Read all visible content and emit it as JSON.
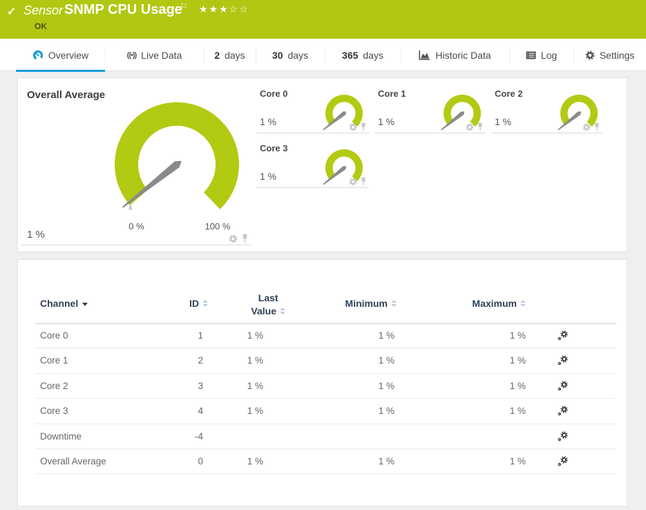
{
  "header": {
    "check": "✓",
    "kind": "Sensor",
    "title": "SNMP CPU Usage",
    "flag": "⚐",
    "stars_filled": "★★★",
    "stars_empty": "☆☆",
    "status": "OK"
  },
  "tabs": {
    "overview_label": "Overview",
    "live_label": "Live Data",
    "d2_num": "2",
    "d2_label": "days",
    "d30_num": "30",
    "d30_label": "days",
    "d365_num": "365",
    "d365_label": "days",
    "historic_label": "Historic Data",
    "log_label": "Log",
    "settings_label": "Settings",
    "live_icon_glyph": "((•))"
  },
  "gauges": {
    "overall": {
      "title": "Overall Average",
      "value": 1,
      "value_label": "1 %",
      "min_label": "0 %",
      "max_label": "100 %",
      "mean_marker": "x̄"
    },
    "cores": [
      {
        "title": "Core 0",
        "value": 1,
        "value_label": "1 %"
      },
      {
        "title": "Core 1",
        "value": 1,
        "value_label": "1 %"
      },
      {
        "title": "Core 2",
        "value": 1,
        "value_label": "1 %"
      },
      {
        "title": "Core 3",
        "value": 1,
        "value_label": "1 %"
      }
    ]
  },
  "table": {
    "headers": {
      "channel": "Channel",
      "id": "ID",
      "last_line1": "Last",
      "last_line2": "Value",
      "minimum": "Minimum",
      "maximum": "Maximum"
    },
    "rows": [
      {
        "channel": "Core 0",
        "id": "1",
        "last": "1 %",
        "min": "1 %",
        "max": "1 %"
      },
      {
        "channel": "Core 1",
        "id": "2",
        "last": "1 %",
        "min": "1 %",
        "max": "1 %"
      },
      {
        "channel": "Core 2",
        "id": "3",
        "last": "1 %",
        "min": "1 %",
        "max": "1 %"
      },
      {
        "channel": "Core 3",
        "id": "4",
        "last": "1 %",
        "min": "1 %",
        "max": "1 %"
      },
      {
        "channel": "Downtime",
        "id": "-4",
        "last": "",
        "min": "",
        "max": ""
      },
      {
        "channel": "Overall Average",
        "id": "0",
        "last": "1 %",
        "min": "1 %",
        "max": "1 %"
      }
    ]
  },
  "colors": {
    "banner_green": "#b1c711",
    "gauge_green": "#b3ca12",
    "needle_gray": "#8a8a8a",
    "accent_blue": "#1b9bd8",
    "status_text": "#4c5414"
  },
  "icons": {
    "check": "check-icon",
    "flag": "flag-icon",
    "stars": "star-rating",
    "gauge": "gauge-icon",
    "broadcast": "broadcast-icon",
    "chart": "area-chart-icon",
    "log": "list-icon",
    "gear": "gear-icon",
    "pin": "pin-icon",
    "gears": "channel-settings-gears-icon"
  }
}
